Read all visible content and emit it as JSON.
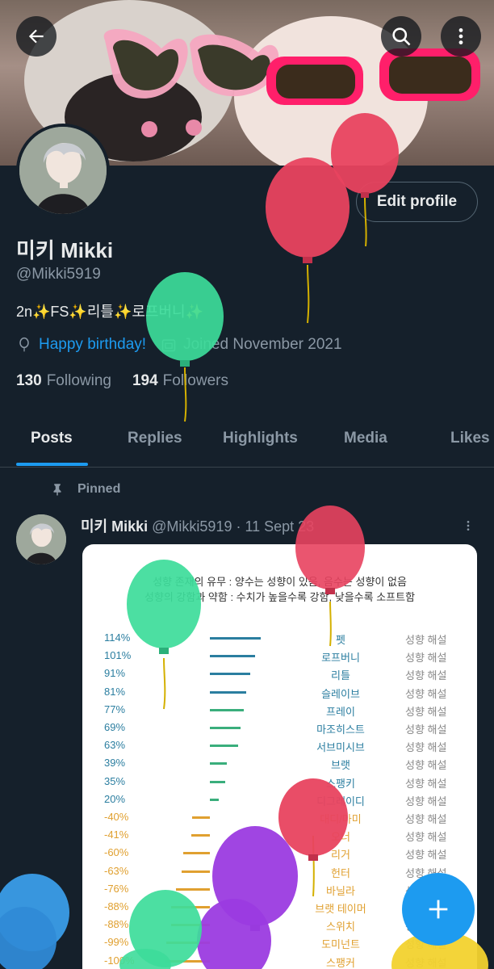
{
  "profile": {
    "display_name": "미키 Mikki",
    "handle": "@Mikki5919",
    "bio": "2n✨FS✨리틀✨로프버니✨",
    "birthday_link": "Happy birthday!",
    "joined": "Joined November 2021",
    "following_count": "130",
    "following_label": "Following",
    "followers_count": "194",
    "followers_label": "Followers",
    "edit_label": "Edit profile"
  },
  "tabs": [
    "Posts",
    "Replies",
    "Highlights",
    "Media",
    "Likes"
  ],
  "post": {
    "pinned_label": "Pinned",
    "author": "미키 Mikki",
    "handle_date": "@Mikki5919 · 11 Sept 23"
  },
  "card": {
    "legend_line1": "성향 존재의 유무 : 양수는 성향이 있음, 음수는 성향이 없음",
    "legend_line2": "성향의 강함과 약함 : 수치가 높을수록 강함, 낮을수록 소프트함",
    "rows": [
      {
        "pct": "114%",
        "value": 114,
        "label": "펫",
        "explain": "성향 해설"
      },
      {
        "pct": "101%",
        "value": 101,
        "label": "로프버니",
        "explain": "성향 해설"
      },
      {
        "pct": "91%",
        "value": 91,
        "label": "리틀",
        "explain": "성향 해설"
      },
      {
        "pct": "81%",
        "value": 81,
        "label": "슬레이브",
        "explain": "성향 해설"
      },
      {
        "pct": "77%",
        "value": 77,
        "label": "프레이",
        "explain": "성향 해설"
      },
      {
        "pct": "69%",
        "value": 69,
        "label": "마조히스트",
        "explain": "성향 해설"
      },
      {
        "pct": "63%",
        "value": 63,
        "label": "서브미시브",
        "explain": "성향 해설"
      },
      {
        "pct": "39%",
        "value": 39,
        "label": "브랫",
        "explain": "성향 해설"
      },
      {
        "pct": "35%",
        "value": 35,
        "label": "스팽키",
        "explain": "성향 해설"
      },
      {
        "pct": "20%",
        "value": 20,
        "label": "디그레이디",
        "explain": "성향 해설"
      },
      {
        "pct": "-40%",
        "value": -40,
        "label": "대디/마미",
        "explain": "성향 해설"
      },
      {
        "pct": "-41%",
        "value": -41,
        "label": "오너",
        "explain": "성향 해설"
      },
      {
        "pct": "-60%",
        "value": -60,
        "label": "리거",
        "explain": "성향 해설"
      },
      {
        "pct": "-63%",
        "value": -63,
        "label": "헌터",
        "explain": "성향 해설"
      },
      {
        "pct": "-76%",
        "value": -76,
        "label": "바닐라",
        "explain": "성향 해설"
      },
      {
        "pct": "-88%",
        "value": -88,
        "label": "브랫 테이머",
        "explain": "성향 해설"
      },
      {
        "pct": "-88%",
        "value": -88,
        "label": "스위치",
        "explain": "성향 해설"
      },
      {
        "pct": "-99%",
        "value": -99,
        "label": "도미넌트",
        "explain": "성향 해설"
      },
      {
        "pct": "-100%",
        "value": -100,
        "label": "스팽커",
        "explain": "성향 해설"
      }
    ]
  },
  "colors": {
    "background": "#15202b",
    "accent": "#1d9bf0",
    "positive_bar": "#2b7ea0",
    "positive_green": "#3aae7c",
    "negative_bar": "#e0a030",
    "balloon_red": "#e8435f",
    "balloon_green": "#3ddc9a",
    "balloon_purple": "#9b3be0",
    "balloon_blue": "#3a9de8"
  },
  "icons": {
    "back": "arrow-left-icon",
    "search": "search-icon",
    "more": "more-vertical-icon",
    "birthday": "balloon-icon",
    "calendar": "calendar-icon",
    "pin": "pin-icon",
    "compose": "plus-icon"
  }
}
